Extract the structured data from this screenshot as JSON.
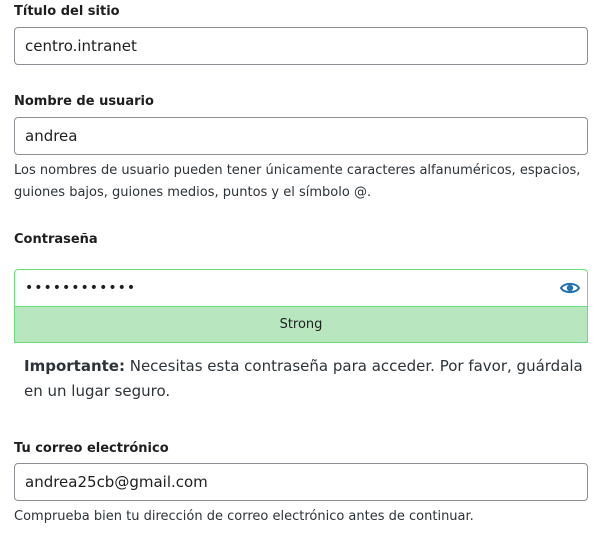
{
  "site_title": {
    "label": "Título del sitio",
    "value": "centro.intranet"
  },
  "username": {
    "label": "Nombre de usuario",
    "value": "andrea",
    "hint": "Los nombres de usuario pueden tener únicamente caracteres alfanuméricos, espacios, guiones bajos, guiones medios, puntos y el símbolo @."
  },
  "password": {
    "label": "Contraseña",
    "value": "••••••••••••",
    "toggle_icon": "eye-icon",
    "strength": "Strong",
    "strength_color": "#b8e6bf",
    "border_color": "#68de7c",
    "important_label": "Importante:",
    "important_text": " Necesitas esta contraseña para acceder. Por favor, guárdala en un lugar seguro."
  },
  "email": {
    "label": "Tu correo electrónico",
    "value": "andrea25cb@gmail.com",
    "hint": "Comprueba bien tu dirección de correo electrónico antes de continuar."
  },
  "colors": {
    "accent": "#2271b1"
  }
}
